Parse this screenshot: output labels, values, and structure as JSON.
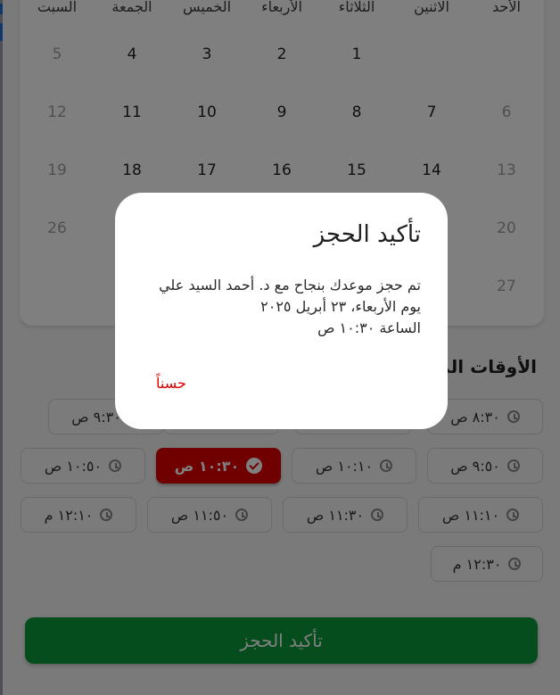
{
  "calendar": {
    "weekdays": [
      "الأحد",
      "الاثنين",
      "الثلاثاء",
      "الأربعاء",
      "الخميس",
      "الجمعة",
      "السبت"
    ],
    "rows": [
      [
        "",
        "",
        "1",
        "2",
        "3",
        "4",
        "5"
      ],
      [
        "6",
        "7",
        "8",
        "9",
        "10",
        "11",
        "12"
      ],
      [
        "13",
        "14",
        "15",
        "16",
        "17",
        "18",
        "19"
      ],
      [
        "20",
        "",
        "",
        "",
        "",
        "",
        "26"
      ],
      [
        "27",
        "",
        "",
        "",
        "",
        "",
        ""
      ]
    ]
  },
  "times_section": {
    "title": "الأوقات الم"
  },
  "time_slots": [
    [
      "٨:٣٠ ص",
      "",
      "",
      "٩:٣٠ ص"
    ],
    [
      "٩:٥٠ ص",
      "١٠:١٠ ص",
      "١٠:٣٠ ص",
      "١٠:٥٠ ص"
    ],
    [
      "١١:١٠ ص",
      "١١:٣٠ ص",
      "١١:٥٠ ص",
      "١٢:١٠ م"
    ],
    [
      "١٢:٣٠ م"
    ]
  ],
  "selected_slot": "١٠:٣٠ ص",
  "confirm_button": {
    "label": "تأكيد الحجز"
  },
  "dialog": {
    "title": "تأكيد الحجز",
    "line1": "تم حجز موعدك بنجاح مع د. أحمد السيد علي",
    "line2": "يوم الأربعاء، ٢٣ أبريل ٢٠٢٥",
    "line3": "الساعة ١٠:٣٠ ص",
    "ok_label": "حسناً"
  },
  "colors": {
    "accent": "#e00000",
    "confirm": "#0a9a3a"
  }
}
